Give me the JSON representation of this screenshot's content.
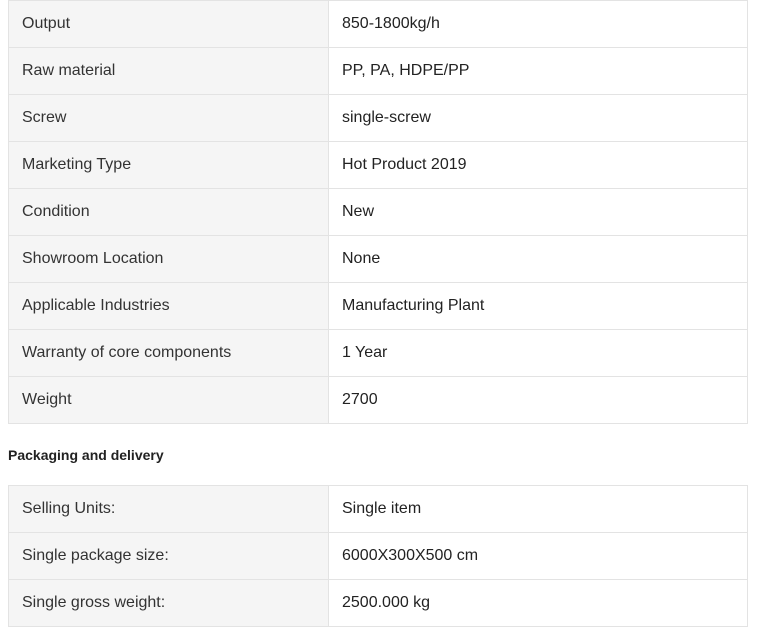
{
  "attributes": {
    "rows": [
      {
        "label": "Output",
        "value": "850-1800kg/h"
      },
      {
        "label": "Raw material",
        "value": "PP, PA, HDPE/PP"
      },
      {
        "label": "Screw",
        "value": "single-screw"
      },
      {
        "label": "Marketing Type",
        "value": "Hot Product 2019"
      },
      {
        "label": "Condition",
        "value": "New"
      },
      {
        "label": "Showroom Location",
        "value": "None"
      },
      {
        "label": "Applicable Industries",
        "value": "Manufacturing Plant"
      },
      {
        "label": "Warranty of core components",
        "value": "1 Year"
      },
      {
        "label": "Weight",
        "value": "2700"
      }
    ]
  },
  "packaging": {
    "heading": "Packaging and delivery",
    "rows": [
      {
        "label": "Selling Units:",
        "value": "Single item"
      },
      {
        "label": "Single package size:",
        "value": "6000X300X500 cm"
      },
      {
        "label": "Single gross weight:",
        "value": "2500.000 kg"
      }
    ]
  }
}
